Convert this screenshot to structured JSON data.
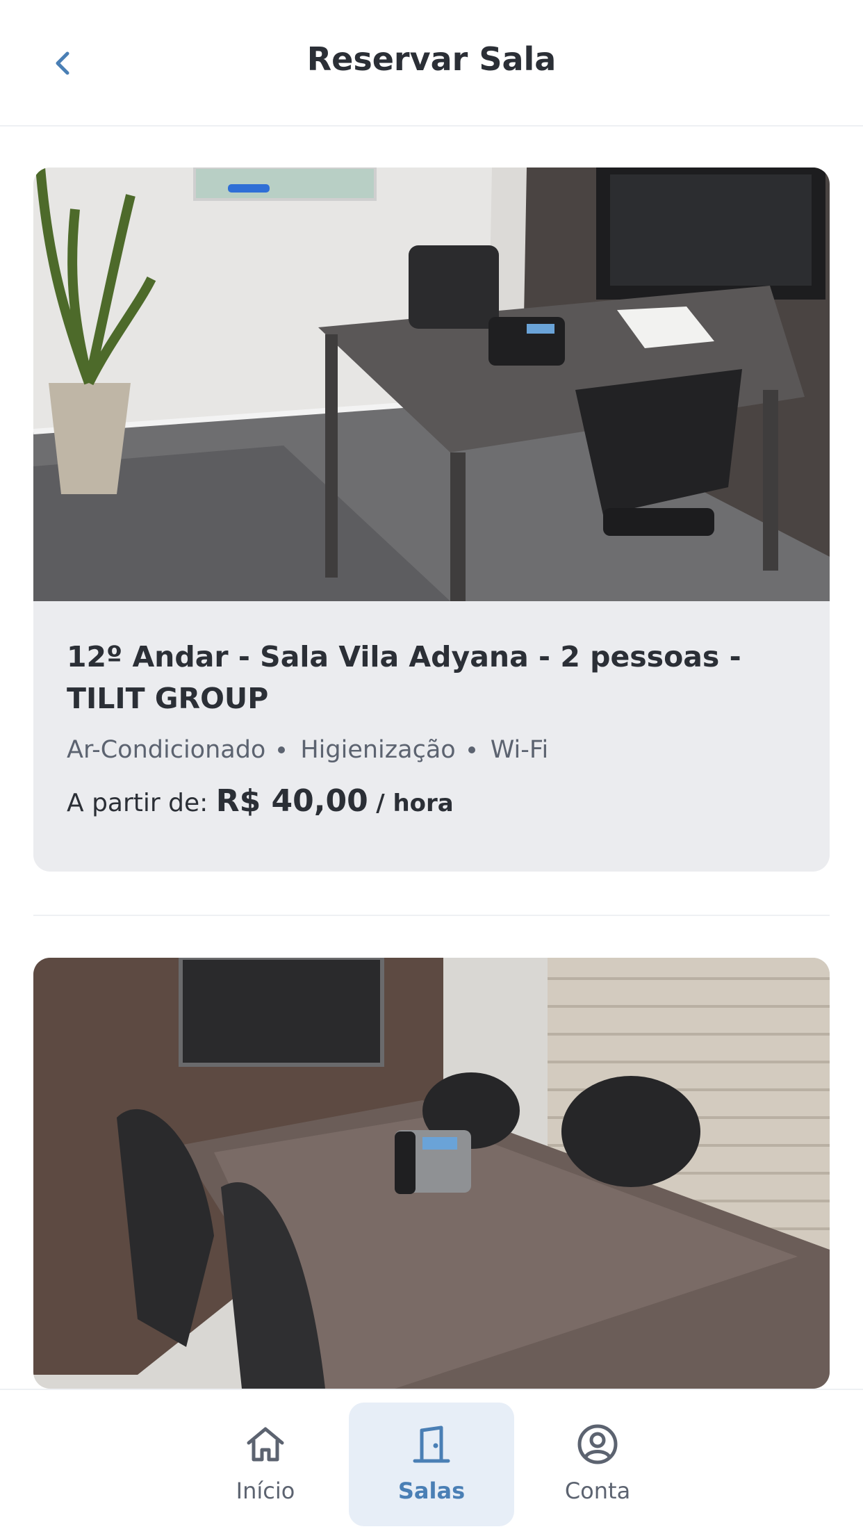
{
  "header": {
    "title": "Reservar Sala",
    "back_icon": "chevron-left-icon"
  },
  "rooms": [
    {
      "title": "12º Andar - Sala Vila Adyana - 2 pessoas - TILIT GROUP",
      "amenities": [
        "Ar-Condicionado",
        "Higienização",
        "Wi-Fi"
      ],
      "price_prefix": "A partir de:",
      "price": "R$ 40,00",
      "price_unit": "/ hora",
      "image": "office room with desk, phone, two chairs, TV and plant"
    },
    {
      "image": "meeting room with wooden table, phone, four black chairs, TV and blinds"
    }
  ],
  "tabbar": {
    "tabs": [
      {
        "label": "Início",
        "icon": "home-icon",
        "active": false
      },
      {
        "label": "Salas",
        "icon": "door-icon",
        "active": true
      },
      {
        "label": "Conta",
        "icon": "user-circle-icon",
        "active": false
      }
    ]
  },
  "colors": {
    "accent": "#4a7fb5",
    "card_bg": "#ebecef",
    "active_tab_bg": "#e7eef7",
    "text": "#2b2f36",
    "muted": "#5c6370"
  }
}
